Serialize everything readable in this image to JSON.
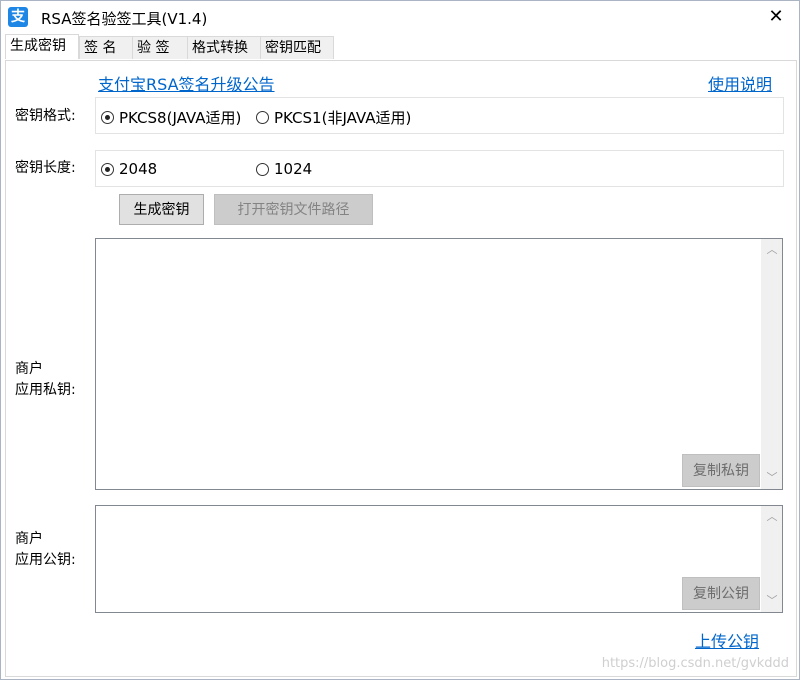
{
  "window": {
    "title": "RSA签名验签工具(V1.4)",
    "icon": "支",
    "close": "✕"
  },
  "tabs": [
    {
      "label": "生成密钥",
      "active": true
    },
    {
      "label": "签 名"
    },
    {
      "label": "验 签"
    },
    {
      "label": "格式转换"
    },
    {
      "label": "密钥匹配"
    }
  ],
  "links": {
    "announcement": "支付宝RSA签名升级公告",
    "help": "使用说明",
    "upload": "上传公钥"
  },
  "key_format": {
    "label": "密钥格式:",
    "options": [
      "PKCS8(JAVA适用)",
      "PKCS1(非JAVA适用)"
    ],
    "selected": "PKCS8(JAVA适用)"
  },
  "key_length": {
    "label": "密钥长度:",
    "options": [
      "2048",
      "1024"
    ],
    "selected": "2048"
  },
  "buttons": {
    "generate": "生成密钥",
    "open_path": "打开密钥文件路径",
    "copy_private": "复制私钥",
    "copy_public": "复制公钥"
  },
  "private_key": {
    "label_line1": "商户",
    "label_line2": "应用私钥:",
    "value": ""
  },
  "public_key": {
    "label_line1": "商户",
    "label_line2": "应用公钥:",
    "value": ""
  },
  "watermark": "https://blog.csdn.net/gvkddd"
}
